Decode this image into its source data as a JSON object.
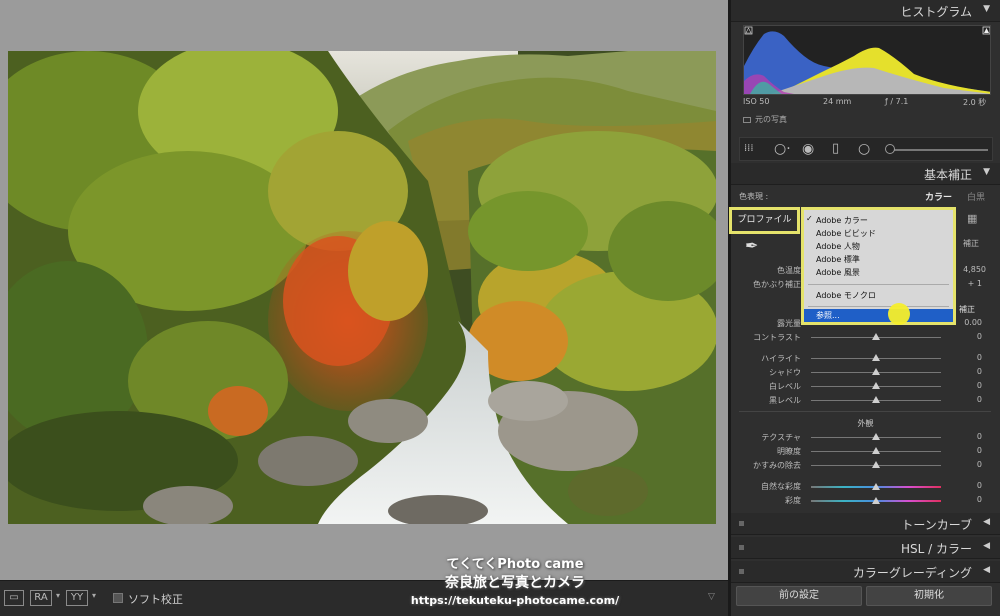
{
  "toolbar": {
    "ra_label": "RA",
    "yy_label": "YY",
    "soft_proof_label": "ソフト校正"
  },
  "panel": {
    "histogram": {
      "title": "ヒストグラム",
      "iso": "ISO 50",
      "focal": "24 mm",
      "aperture": "ƒ / 7.1",
      "shutter": "2.0 秒",
      "original_photo": "元の写真"
    },
    "basic": {
      "title": "基本補正",
      "treatment_label": "色表現 :",
      "treatment_color": "カラー",
      "treatment_bw": "白黒",
      "profile_label": "プロファイル",
      "wb_fragment": "補正",
      "temp_label": "色温度",
      "temp_value": "4,850",
      "tint_label": "色かぶり補正",
      "tint_value": "+ 1",
      "tone_auto": "補正",
      "exposure_label": "露光量",
      "exposure_value": "0.00",
      "contrast_label": "コントラスト",
      "contrast_value": "0",
      "highlights_label": "ハイライト",
      "highlights_value": "0",
      "shadows_label": "シャドウ",
      "shadows_value": "0",
      "whites_label": "白レベル",
      "whites_value": "0",
      "blacks_label": "黒レベル",
      "blacks_value": "0",
      "presence_label": "外観",
      "texture_label": "テクスチャ",
      "texture_value": "0",
      "clarity_label": "明瞭度",
      "clarity_value": "0",
      "dehaze_label": "かすみの除去",
      "dehaze_value": "0",
      "vibrance_label": "自然な彩度",
      "vibrance_value": "0",
      "saturation_label": "彩度",
      "saturation_value": "0"
    },
    "profile_menu": {
      "check": "✓",
      "items": [
        "Adobe カラー",
        "Adobe ビビッド",
        "Adobe 人物",
        "Adobe 標準",
        "Adobe 風景",
        "Adobe モノクロ",
        "参照..."
      ]
    },
    "tone_curve_title": "トーンカーブ",
    "hsl_title": "HSL / カラー",
    "color_grading_title": "カラーグレーディング",
    "prev_button": "前の設定",
    "reset_button": "初期化"
  },
  "watermark": {
    "line1": "てくてくPhoto came",
    "line2": "奈良旅と写真とカメラ",
    "line3": "https://tekuteku-photocame.com/"
  }
}
